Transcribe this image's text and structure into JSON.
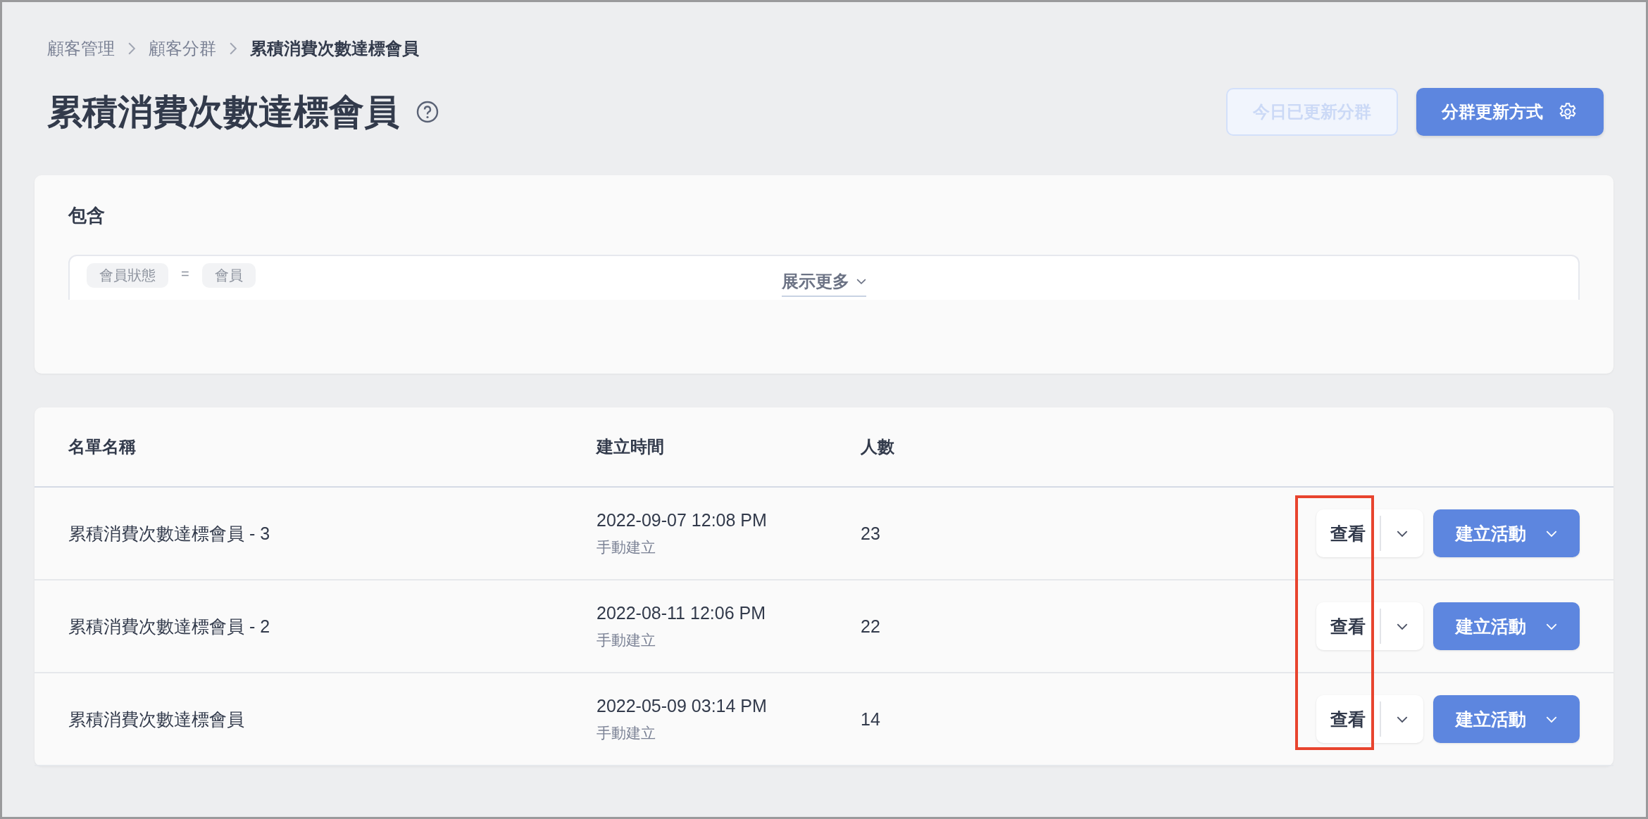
{
  "breadcrumb": [
    {
      "label": "顧客管理",
      "current": false
    },
    {
      "label": "顧客分群",
      "current": false
    },
    {
      "label": "累積消費次數達標會員",
      "current": true
    }
  ],
  "title": "累積消費次數達標會員",
  "header_buttons": [
    {
      "label": "今日已更新分群",
      "kind": "plain",
      "disabled": true
    },
    {
      "label": "分群更新方式",
      "kind": "settings",
      "disabled": false
    }
  ],
  "conditions": {
    "heading": "包含",
    "chips": [
      "會員狀態",
      "=",
      "會員"
    ],
    "toggle": "展示更多"
  },
  "table": {
    "columns": [
      "名單名稱",
      "建立時間",
      "人數"
    ],
    "rows": [
      {
        "name": "累積消費次數達標會員 - 3",
        "created": "2022-09-07 12:08 PM",
        "source": "手動建立",
        "count": "23",
        "view": "查看",
        "action": "建立活動"
      },
      {
        "name": "累積消費次數達標會員 - 2",
        "created": "2022-08-11 12:06 PM",
        "source": "手動建立",
        "count": "22",
        "view": "查看",
        "action": "建立活動"
      },
      {
        "name": "累積消費次數達標會員",
        "created": "2022-05-09 03:14 PM",
        "source": "手動建立",
        "count": "14",
        "view": "查看",
        "action": "建立活動"
      }
    ],
    "view_column_highlighted": true
  }
}
